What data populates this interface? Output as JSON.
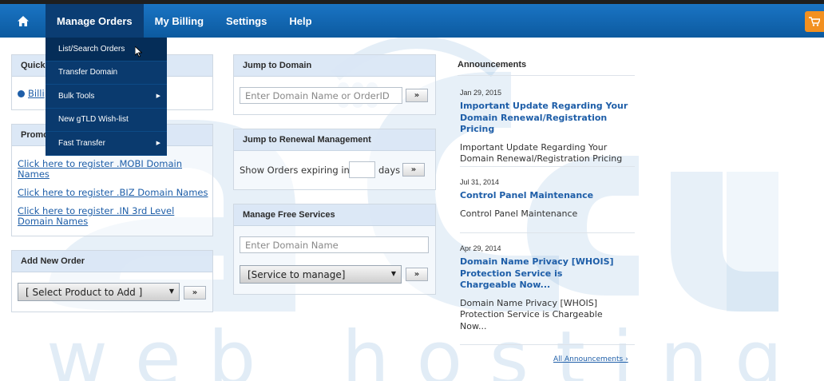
{
  "nav": {
    "home_icon": "home-icon",
    "items": [
      "Manage Orders",
      "My Billing",
      "Settings",
      "Help"
    ],
    "cart_icon": "cart-icon"
  },
  "dropdown": {
    "items": [
      {
        "label": "List/Search Orders",
        "submenu": false
      },
      {
        "label": "Transfer Domain",
        "submenu": false
      },
      {
        "label": "Bulk Tools",
        "submenu": true
      },
      {
        "label": "New gTLD Wish-list",
        "submenu": false
      },
      {
        "label": "Fast Transfer",
        "submenu": true
      }
    ]
  },
  "quick": {
    "title": "Quick",
    "link": "Billi"
  },
  "promo": {
    "title": "Promo",
    "links": [
      "Click here to register .MOBI Domain Names",
      "Click here to register .BIZ Domain Names",
      "Click here to register .IN 3rd Level Domain Names"
    ]
  },
  "add_order": {
    "title": "Add New Order",
    "select_value": "[ Select Product to Add ]",
    "go_label": "»"
  },
  "jump_domain": {
    "title": "Jump to Domain",
    "placeholder": "Enter Domain Name or OrderID",
    "go_label": "»"
  },
  "renewal": {
    "title": "Jump to Renewal Management",
    "prefix": "Show Orders expiring in",
    "suffix": "days",
    "go_label": "»"
  },
  "free_services": {
    "title": "Manage Free Services",
    "placeholder": "Enter Domain Name",
    "select_value": "[Service to manage]",
    "go_label": "»"
  },
  "announcements": {
    "title": "Announcements",
    "entries": [
      {
        "date": "Jan 29, 2015",
        "title": "Important Update Regarding Your Domain Renewal/Registration Pricing",
        "body": "Important Update Regarding Your Domain Renewal/Registration Pricing"
      },
      {
        "date": "Jul 31, 2014",
        "title": "Control Panel Maintenance",
        "body": "Control Panel Maintenance"
      },
      {
        "date": "Apr 29, 2014",
        "title": "Domain Name Privacy [WHOIS] Protection Service is Chargeable Now...",
        "body": "Domain Name Privacy [WHOIS] Protection Service is Chargeable Now..."
      }
    ],
    "all_link": "All Announcements ›"
  },
  "watermark": {
    "letters": [
      "w",
      "e",
      "b",
      "h",
      "o",
      "s",
      "t",
      "i",
      "n",
      "g"
    ],
    "color": "#78aad7"
  },
  "colors": {
    "nav_bg": "#0c5a9f",
    "nav_active": "#0b3d73",
    "link": "#1e5ea8",
    "cart": "#f29020"
  }
}
